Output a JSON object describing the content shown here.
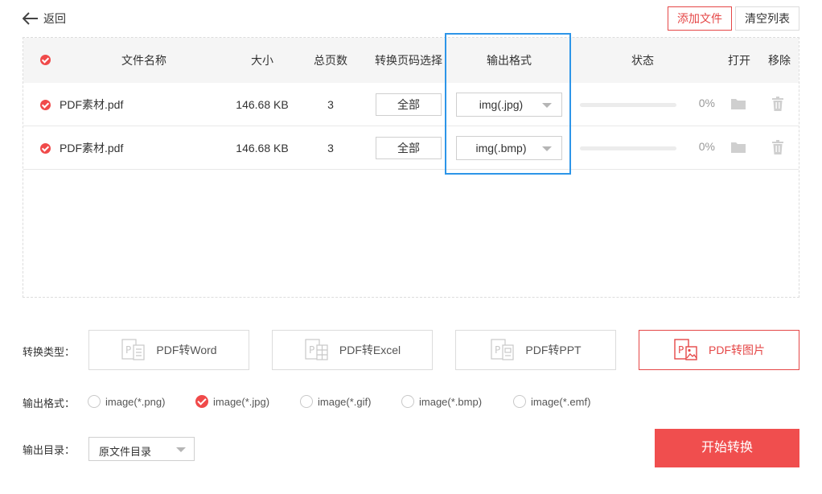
{
  "header": {
    "back_label": "返回",
    "add_file": "添加文件",
    "clear_list": "清空列表"
  },
  "table": {
    "columns": {
      "name": "文件名称",
      "size": "大小",
      "pages": "总页数",
      "page_select": "转换页码选择",
      "output_format": "输出格式",
      "status": "状态",
      "open": "打开",
      "remove": "移除"
    },
    "rows": [
      {
        "name": "PDF素材.pdf",
        "size": "146.68 KB",
        "pages": "3",
        "page_range": "全部",
        "format": "img(.jpg)",
        "progress": "0%"
      },
      {
        "name": "PDF素材.pdf",
        "size": "146.68 KB",
        "pages": "3",
        "page_range": "全部",
        "format": "img(.bmp)",
        "progress": "0%"
      }
    ]
  },
  "convert_type": {
    "label": "转换类型：",
    "options": [
      "PDF转Word",
      "PDF转Excel",
      "PDF转PPT",
      "PDF转图片"
    ],
    "selected": "PDF转图片"
  },
  "output_format": {
    "label": "输出格式：",
    "options": [
      "image(*.png)",
      "image(*.jpg)",
      "image(*.gif)",
      "image(*.bmp)",
      "image(*.emf)"
    ],
    "selected": "image(*.jpg)"
  },
  "output_dir": {
    "label": "输出目录：",
    "value": "原文件目录"
  },
  "start_button": "开始转换",
  "colors": {
    "accent": "#f04e4e",
    "highlight": "#2d95e8"
  }
}
